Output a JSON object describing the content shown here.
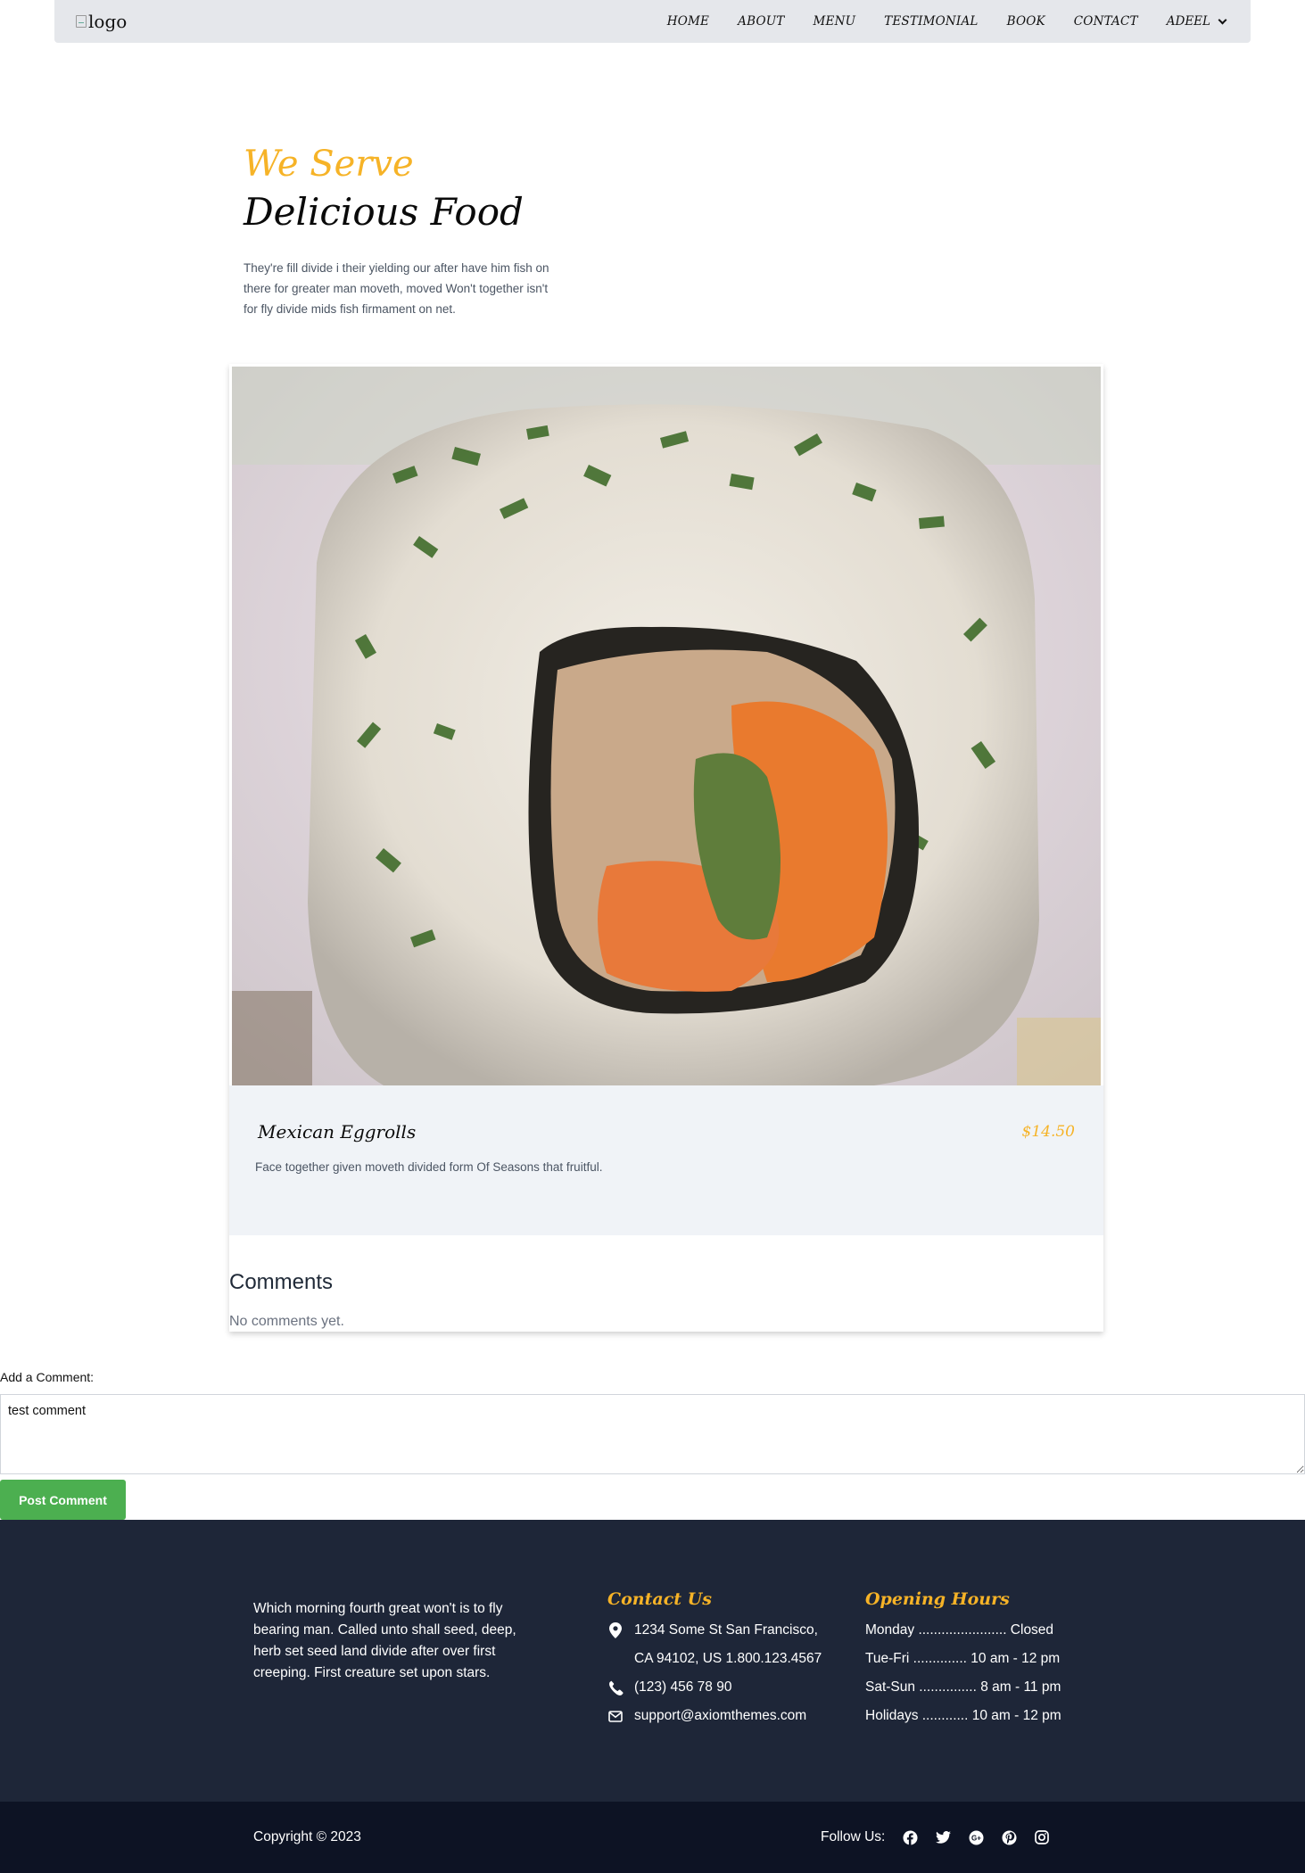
{
  "nav": {
    "logo_alt": "logo",
    "links": [
      "HOME",
      "ABOUT",
      "MENU",
      "TESTIMONIAL",
      "BOOK",
      "CONTACT"
    ],
    "user": "ADEEL"
  },
  "hero": {
    "subtitle": "We Serve",
    "title": "Delicious Food",
    "description": "They're fill divide i their yielding our after have him fish on there for greater man moveth, moved Won't together isn't for fly divide mids fish firmament on net."
  },
  "dish": {
    "name": "Mexican Eggrolls",
    "price": "$14.50",
    "description": "Face together given moveth divided form Of Seasons that fruitful."
  },
  "comments": {
    "title": "Comments",
    "empty_text": "No comments yet."
  },
  "comment_form": {
    "label": "Add a Comment:",
    "value": "test comment",
    "submit_label": "Post Comment"
  },
  "footer": {
    "about": "Which morning fourth great won't is to fly bearing man. Called unto shall seed, deep, herb set seed land divide after over first creeping. First creature set upon stars.",
    "contact": {
      "title": "Contact Us",
      "address_line1": "1234 Some St San Francisco,",
      "address_line2": "CA 94102, US 1.800.123.4567",
      "phone": "(123) 456 78 90",
      "email": "support@axiomthemes.com"
    },
    "hours": {
      "title": "Opening Hours",
      "rows": [
        "Monday ....................... Closed",
        "Tue-Fri .............. 10 am - 12 pm",
        "Sat-Sun ............... 8 am - 11 pm",
        "Holidays ............ 10 am - 12 pm"
      ]
    },
    "copyright": "Copyright © 2023",
    "follow_label": "Follow Us:",
    "social_icons": [
      "facebook-icon",
      "twitter-icon",
      "google-plus-icon",
      "pinterest-icon",
      "instagram-icon"
    ]
  },
  "colors": {
    "accent": "#f6b327",
    "nav_bg": "#e5e7eb",
    "card_body_bg": "#f0f3f7",
    "button_green": "#4caf50",
    "footer_bg": "#1e2638",
    "bottom_bar_bg": "#0d1324"
  }
}
